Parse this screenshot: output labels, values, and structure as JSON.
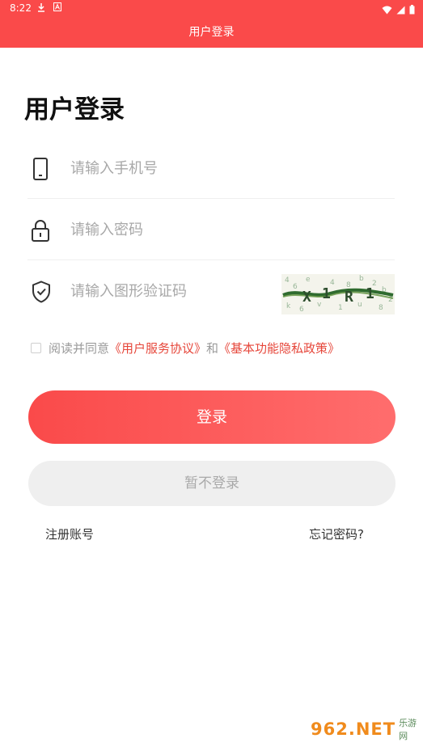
{
  "status_bar": {
    "time": "8:22",
    "icons": [
      "download-icon",
      "a-icon",
      "wifi-icon",
      "cell-signal-icon",
      "battery-icon"
    ]
  },
  "app_bar": {
    "title": "用户登录"
  },
  "page": {
    "heading": "用户登录"
  },
  "form": {
    "phone": {
      "placeholder": "请输入手机号",
      "icon": "phone-icon"
    },
    "password": {
      "placeholder": "请输入密码",
      "icon": "lock-icon"
    },
    "captcha": {
      "placeholder": "请输入图形验证码",
      "icon": "shield-check-icon"
    }
  },
  "agreement": {
    "prefix": "阅读并同意",
    "user_agreement": "《用户服务协议》",
    "conjunction": "和",
    "privacy_policy": "《基本功能隐私政策》",
    "checked": false
  },
  "buttons": {
    "login": "登录",
    "skip": "暂不登录"
  },
  "links": {
    "register": "注册账号",
    "forgot": "忘记密码?"
  },
  "watermark": {
    "text": "962.NET",
    "sub": "乐游网"
  },
  "colors": {
    "brand": "#fa4a4a",
    "link": "#e6463a",
    "placeholder": "#a8a8a8",
    "disabled_button": "#efefef"
  }
}
